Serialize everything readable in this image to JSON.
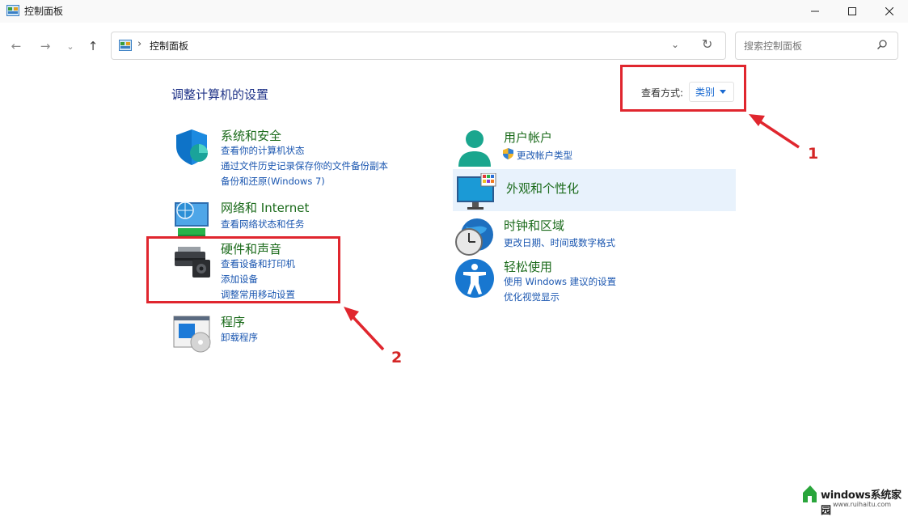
{
  "window": {
    "title": "控制面板"
  },
  "address": {
    "crumb": "控制面板"
  },
  "search": {
    "placeholder": "搜索控制面板"
  },
  "main": {
    "heading": "调整计算机的设置",
    "viewby_label": "查看方式:",
    "viewby_value": "类别"
  },
  "categories": [
    {
      "title": "系统和安全",
      "links": [
        "查看你的计算机状态",
        "通过文件历史记录保存你的文件备份副本",
        "备份和还原(Windows 7)"
      ],
      "icon": "shield-icon"
    },
    {
      "title": "网络和 Internet",
      "links": [
        "查看网络状态和任务"
      ],
      "icon": "network-globe-icon"
    },
    {
      "title": "硬件和声音",
      "links": [
        "查看设备和打印机",
        "添加设备",
        "调整常用移动设置"
      ],
      "icon": "printer-speaker-icon"
    },
    {
      "title": "程序",
      "links": [
        "卸载程序"
      ],
      "icon": "programs-disc-icon"
    },
    {
      "title": "用户帐户",
      "links": [
        "更改帐户类型"
      ],
      "icon": "user-icon"
    },
    {
      "title": "外观和个性化",
      "links": [],
      "icon": "monitor-palette-icon"
    },
    {
      "title": "时钟和区域",
      "links": [
        "更改日期、时间或数字格式"
      ],
      "icon": "clock-globe-icon"
    },
    {
      "title": "轻松使用",
      "links": [
        "使用 Windows 建议的设置",
        "优化视觉显示"
      ],
      "icon": "accessibility-icon"
    }
  ],
  "annotations": {
    "label1": "1",
    "label2": "2"
  },
  "watermark": {
    "text": "windows系统家园",
    "url": "www.ruihaitu.com"
  },
  "colors": {
    "accent_red": "#e0262e",
    "link_blue": "#1a56b0",
    "title_green": "#1a6a1a",
    "hover_bg": "#e8f2fc"
  }
}
